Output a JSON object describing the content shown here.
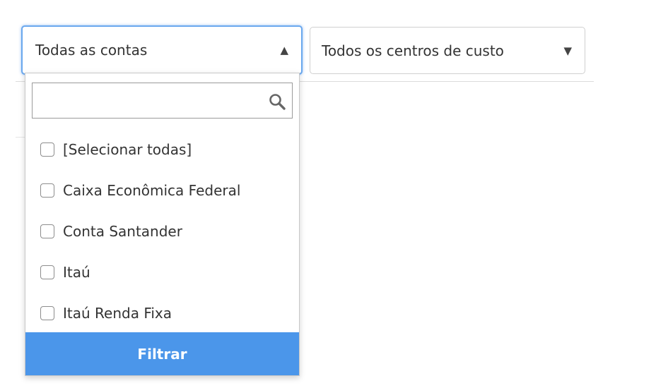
{
  "account_select": {
    "value": "Todas as contas",
    "caret_icon": "caret-up-icon",
    "state": "open"
  },
  "cost_center_select": {
    "value": "Todos os centros de custo",
    "caret_icon": "caret-down-icon"
  },
  "dropdown": {
    "search": {
      "value": "",
      "placeholder": "",
      "icon": "search-icon"
    },
    "options": [
      {
        "label": "[Selecionar todas]",
        "checked": false
      },
      {
        "label": "Caixa Econômica Federal",
        "checked": false
      },
      {
        "label": "Conta Santander",
        "checked": false
      },
      {
        "label": "Itaú",
        "checked": false
      },
      {
        "label": "Itaú Renda Fixa",
        "checked": false
      }
    ],
    "filter_label": "Filtrar"
  },
  "colors": {
    "accent": "#4b96ea",
    "focus_border": "#6aa8ee",
    "border": "#d0d0d0",
    "text": "#333333"
  }
}
